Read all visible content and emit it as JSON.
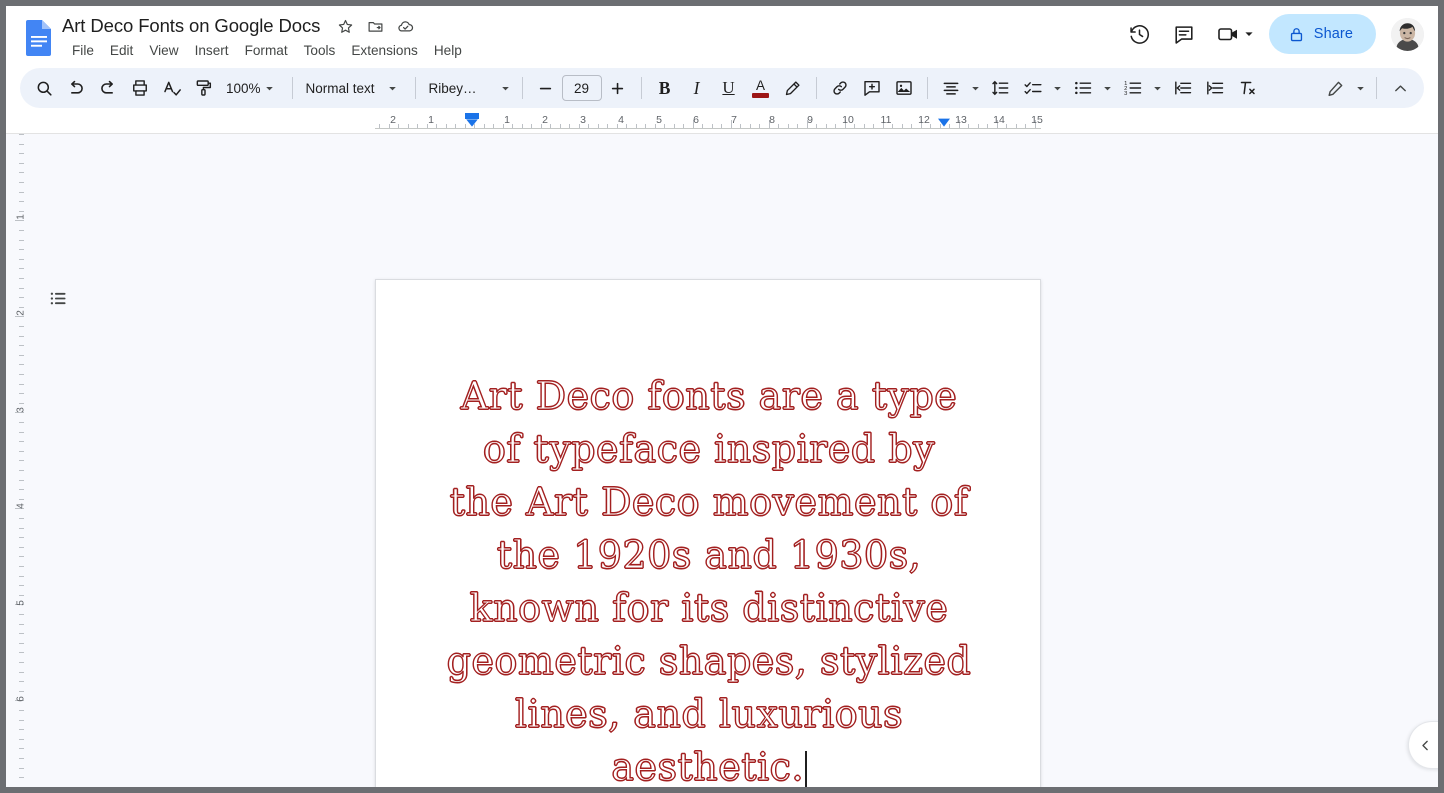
{
  "app": {
    "name": "Google Docs"
  },
  "header": {
    "doc_title": "Art Deco Fonts on Google Docs",
    "logo_icon": "google-docs-logo-icon",
    "title_icons": [
      {
        "name": "star-icon",
        "label": "Star"
      },
      {
        "name": "move-to-folder-icon",
        "label": "Move"
      },
      {
        "name": "cloud-saved-icon",
        "label": "Saved to Drive"
      }
    ],
    "menus": [
      {
        "label": "File"
      },
      {
        "label": "Edit"
      },
      {
        "label": "View"
      },
      {
        "label": "Insert"
      },
      {
        "label": "Format"
      },
      {
        "label": "Tools"
      },
      {
        "label": "Extensions"
      },
      {
        "label": "Help"
      }
    ],
    "right_actions": [
      {
        "name": "version-history-icon",
        "label": "Version history"
      },
      {
        "name": "comment-history-icon",
        "label": "Open comment history"
      },
      {
        "name": "meet-camera-icon",
        "label": "Join or start a meeting"
      }
    ],
    "share": {
      "label": "Share",
      "icon": "lock-icon",
      "bg_color": "#c2e7ff",
      "text_color": "#0b57d0"
    },
    "avatar": {
      "name": "user-avatar",
      "label": "Account"
    }
  },
  "toolbar": {
    "background": "#edf2fa",
    "search": {
      "icon": "search-icon",
      "label": "Search the menus"
    },
    "undo": {
      "icon": "undo-icon",
      "label": "Undo"
    },
    "redo": {
      "icon": "redo-icon",
      "label": "Redo"
    },
    "print": {
      "icon": "print-icon",
      "label": "Print"
    },
    "spellcheck": {
      "icon": "spellcheck-icon",
      "label": "Spelling and grammar check"
    },
    "paint_format": {
      "icon": "paint-format-icon",
      "label": "Paint format"
    },
    "zoom": {
      "value": "100%",
      "caret": "chevron-down-icon"
    },
    "paragraph_style": {
      "value": "Normal text",
      "caret": "chevron-down-icon"
    },
    "font": {
      "value": "Ribey…",
      "full_value": "Ribeye",
      "caret": "chevron-down-icon"
    },
    "font_size": {
      "value": "29",
      "decrease": "minus-icon",
      "increase": "plus-icon"
    },
    "bold": {
      "label": "B",
      "icon": "bold-icon"
    },
    "italic": {
      "label": "I",
      "icon": "italic-icon"
    },
    "underline": {
      "label": "U",
      "icon": "underline-icon"
    },
    "text_color": {
      "label": "A",
      "icon": "text-color-icon",
      "swatch": "#9c1616"
    },
    "highlight": {
      "icon": "highlight-pen-icon"
    },
    "insert_link": {
      "icon": "link-icon"
    },
    "add_comment": {
      "icon": "add-comment-icon"
    },
    "insert_image": {
      "icon": "insert-image-icon"
    },
    "align": {
      "icon": "align-center-icon",
      "caret": "chevron-down-icon"
    },
    "line_spacing": {
      "icon": "line-spacing-icon"
    },
    "checklist": {
      "icon": "checklist-icon",
      "caret": "chevron-down-icon"
    },
    "bulleted_list": {
      "icon": "bulleted-list-icon",
      "caret": "chevron-down-icon"
    },
    "numbered_list": {
      "icon": "numbered-list-icon",
      "caret": "chevron-down-icon"
    },
    "decrease_indent": {
      "icon": "decrease-indent-icon"
    },
    "increase_indent": {
      "icon": "increase-indent-icon"
    },
    "clear_formatting": {
      "icon": "clear-formatting-icon"
    },
    "editing_mode": {
      "icon": "edit-pencil-icon",
      "caret": "chevron-down-icon"
    },
    "hide_toolbar": {
      "icon": "chevron-up-icon"
    }
  },
  "ruler": {
    "horizontal_numbers": [
      "2",
      "1",
      "1",
      "2",
      "3",
      "4",
      "5",
      "6",
      "7",
      "8",
      "9",
      "10",
      "11",
      "12",
      "13",
      "14",
      "15"
    ],
    "left_indent_marker": "left-indent-marker",
    "right_indent_marker": "right-indent-marker",
    "marker_color": "#1a73e8",
    "vertical_numbers": [
      "1",
      "2",
      "3",
      "4",
      "5",
      "6"
    ]
  },
  "sidebar": {
    "outline_button": {
      "icon": "document-outline-icon",
      "label": "Show document outline"
    }
  },
  "document": {
    "text_color": "#a32020",
    "alignment": "center",
    "lines": [
      "Art Deco fonts are a",
      "type of typeface",
      "inspired by the Art",
      "Deco movement of the",
      "1920s and 1930s, known",
      "for its distinctive",
      "geometric shapes,",
      "stylized lines, and",
      "luxurious aesthetic."
    ],
    "full_text": "Art Deco fonts are a type of typeface inspired by the Art Deco movement of the 1920s and 1930s, known for its distinctive geometric shapes, stylized lines, and luxurious aesthetic.",
    "cursor_visible": true
  },
  "side_panel": {
    "toggle": {
      "icon": "chevron-left-icon",
      "label": "Show side panel"
    }
  }
}
